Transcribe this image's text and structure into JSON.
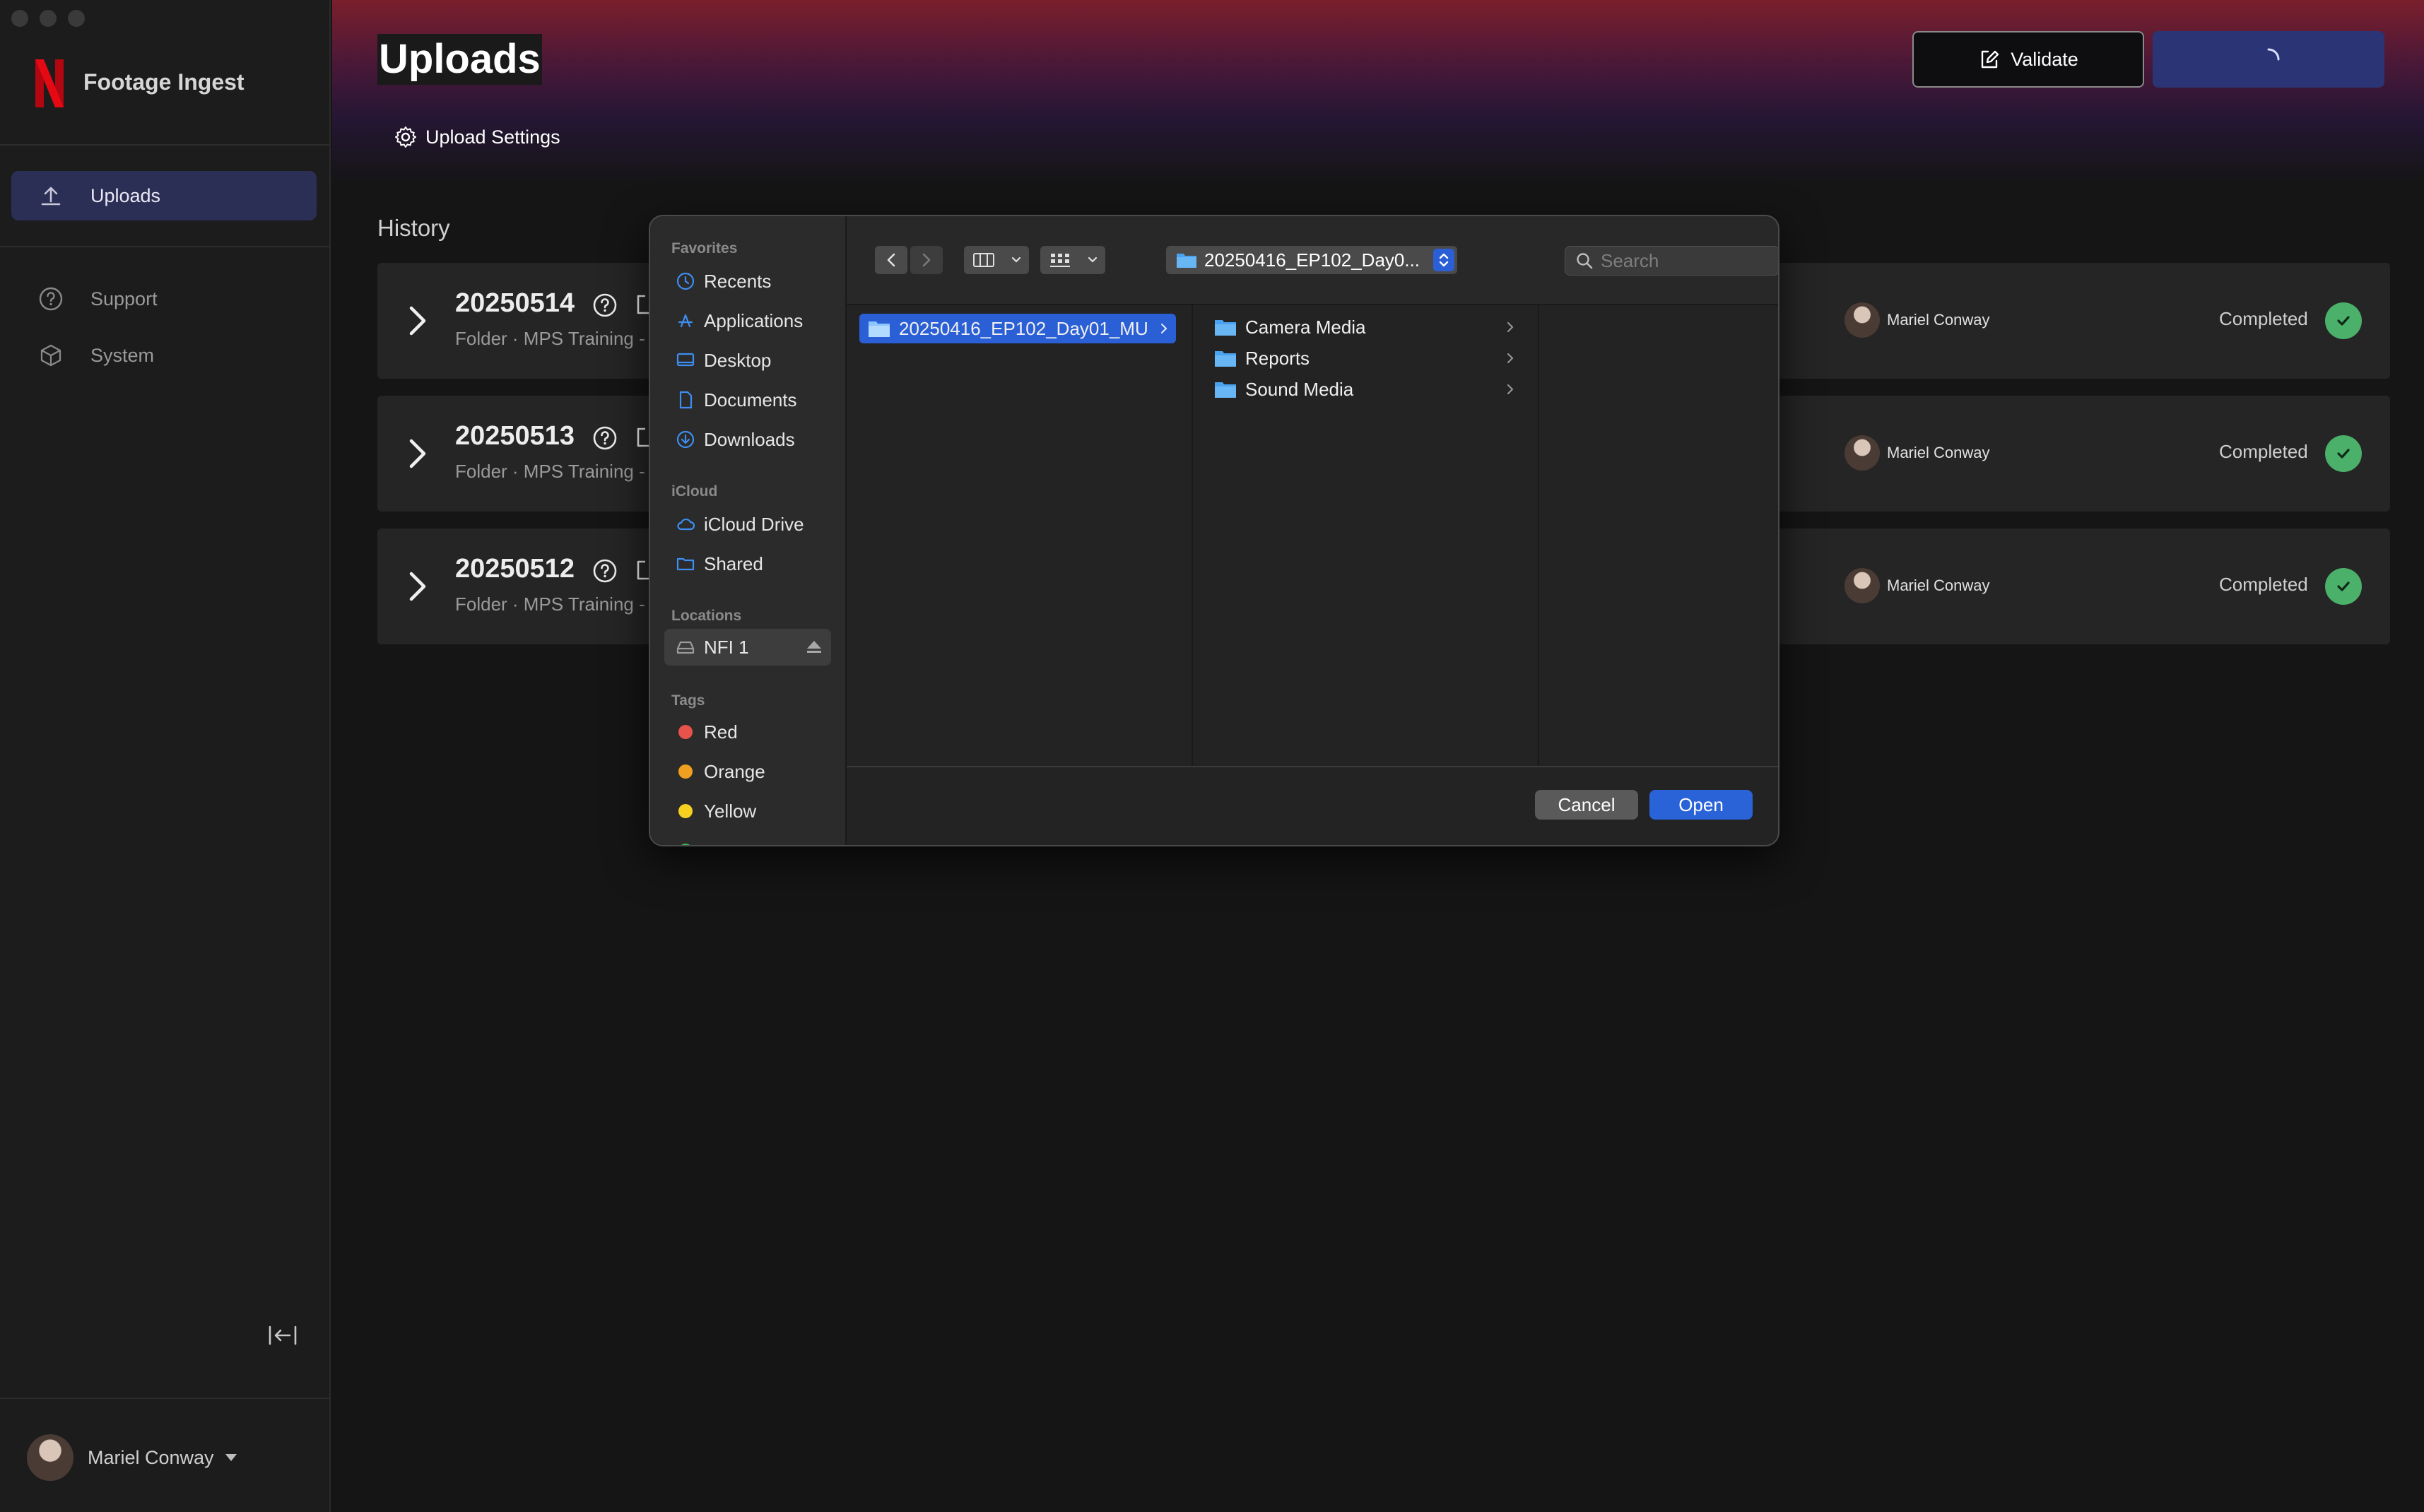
{
  "app": {
    "title": "Footage Ingest"
  },
  "sidebar": {
    "items": [
      {
        "label": "Uploads",
        "icon": "upload-icon",
        "active": true
      },
      {
        "label": "Support",
        "icon": "help-circle-icon"
      },
      {
        "label": "System",
        "icon": "cube-icon"
      }
    ],
    "user": {
      "name": "Mariel Conway"
    }
  },
  "header": {
    "title": "Uploads",
    "validate_label": "Validate",
    "upload_settings_label": "Upload Settings"
  },
  "history": {
    "title": "History",
    "rows": [
      {
        "title": "20250514",
        "subtitle": "Folder · MPS Training -",
        "user": "Mariel Conway",
        "status": "Completed"
      },
      {
        "title": "20250513",
        "subtitle": "Folder · MPS Training -",
        "user": "Mariel Conway",
        "status": "Completed"
      },
      {
        "title": "20250512",
        "subtitle": "Folder · MPS Training -",
        "user": "Mariel Conway",
        "status": "Completed"
      }
    ]
  },
  "dialog": {
    "sections": {
      "favorites": "Favorites",
      "icloud": "iCloud",
      "locations": "Locations",
      "tags": "Tags"
    },
    "favorites": [
      "Recents",
      "Applications",
      "Desktop",
      "Documents",
      "Downloads"
    ],
    "icloud": [
      "iCloud Drive",
      "Shared"
    ],
    "locations": [
      "NFI 1"
    ],
    "tags": [
      {
        "label": "Red",
        "color": "#e5534b"
      },
      {
        "label": "Orange",
        "color": "#f0a020"
      },
      {
        "label": "Yellow",
        "color": "#f5d020"
      }
    ],
    "path": "20250416_EP102_Day0...",
    "search_placeholder": "Search",
    "column1": [
      "20250416_EP102_Day01_MU"
    ],
    "column2": [
      "Camera Media",
      "Reports",
      "Sound Media"
    ],
    "cancel_label": "Cancel",
    "open_label": "Open"
  },
  "colors": {
    "accent": "#2a5fd6",
    "sidebar_active": "#2b2f56",
    "status_completed": "#4bb06a",
    "brand_red": "#e50914"
  }
}
